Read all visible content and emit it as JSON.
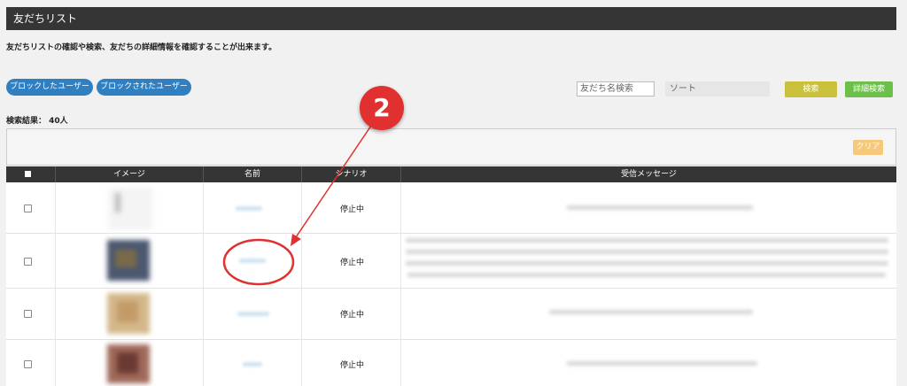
{
  "header": {
    "title": "友だちリスト"
  },
  "description": "友だちリストの確認や検索、友だちの詳細情報を確認することが出来ます。",
  "filters": {
    "blocked_by_me_label": "ブロックしたユーザー",
    "blocked_me_label": "ブロックされたユーザー"
  },
  "search": {
    "name_placeholder": "友だち名検索",
    "sort_value": "ソート",
    "search_button": "検索",
    "advanced_search_button": "詳細検索"
  },
  "results": {
    "count_text": "検索結果： 40人",
    "clear_button": "クリア"
  },
  "table": {
    "columns": [
      "イメージ",
      "名前",
      "シナリオ",
      "受信メッセージ"
    ],
    "rows": [
      {
        "scenario": "停止中"
      },
      {
        "scenario": "停止中"
      },
      {
        "scenario": "停止中"
      },
      {
        "scenario": "停止中"
      }
    ]
  },
  "annotation": {
    "step_number": "2",
    "color": "#e0302f"
  },
  "colors": {
    "header_bg": "#353535",
    "pill_blue": "#2f7fc1",
    "search_btn": "#c9c13b",
    "advanced_btn": "#6cc04a",
    "clear_btn": "#f6c879"
  }
}
